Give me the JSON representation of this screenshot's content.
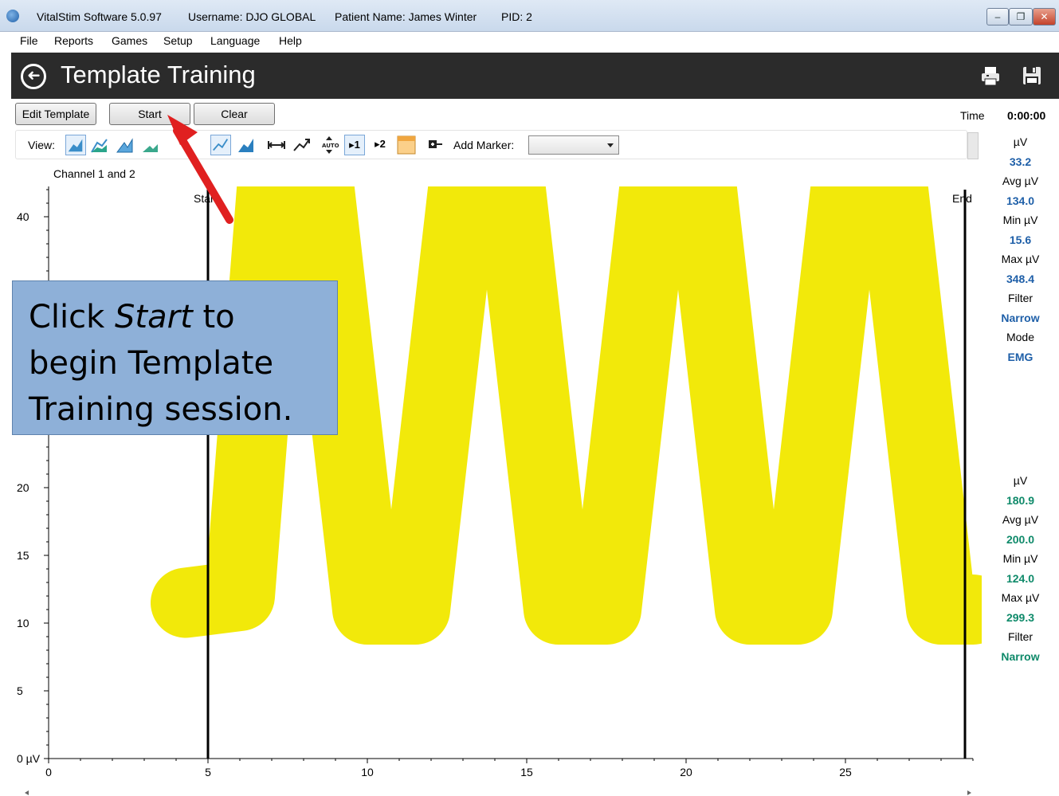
{
  "window": {
    "app_title": "VitalStim Software 5.0.97",
    "username": "Username: DJO GLOBAL",
    "patient": "Patient Name: James Winter",
    "pid": "PID: 2",
    "minimize": "–",
    "maximize": "❐",
    "close": "✕"
  },
  "menu": [
    "File",
    "Reports",
    "Games",
    "Setup",
    "Language",
    "Help"
  ],
  "header": {
    "title": "Template Training",
    "back": "➜"
  },
  "buttons": {
    "edit_template": "Edit Template",
    "start": "Start",
    "clear": "Clear"
  },
  "time": {
    "label": "Time",
    "value": "0:00:00"
  },
  "toolbar": {
    "view_label": "View:",
    "add_marker_label": "Add Marker:",
    "marker_selected": "",
    "channel1": "1",
    "channel2": "2"
  },
  "channel_label": "Channel 1 and 2",
  "stats_ch1": {
    "uv_label": "µV",
    "uv": "33.2",
    "avg_label": "Avg µV",
    "avg": "134.0",
    "min_label": "Min µV",
    "min": "15.6",
    "max_label": "Max µV",
    "max": "348.4",
    "filter_label": "Filter",
    "filter": "Narrow",
    "mode_label": "Mode",
    "mode": "EMG"
  },
  "stats_ch2": {
    "uv_label": "µV",
    "uv": "180.9",
    "avg_label": "Avg µV",
    "avg": "200.0",
    "min_label": "Min µV",
    "min": "124.0",
    "max_label": "Max µV",
    "max": "299.3",
    "filter_label": "Filter",
    "filter": "Narrow"
  },
  "callout": {
    "part1": "Click ",
    "emphasis": "Start",
    "part2": " to begin Template Training session."
  },
  "colors": {
    "template": "#f2e90a",
    "banner": "#2b2b2b",
    "callout": "#8eb0d8",
    "arrow": "#e02020",
    "ch1_value": "#1e5fa8",
    "ch2_value": "#0f8a6a"
  },
  "chart_data": {
    "type": "line",
    "title": "",
    "xlabel": "",
    "ylabel": "",
    "xlim": [
      0,
      29
    ],
    "ylim": [
      0,
      40
    ],
    "x_ticks": [
      "0",
      "5",
      "10",
      "15",
      "20",
      "25"
    ],
    "y_ticks": [
      "0 µV",
      "5",
      "10",
      "15",
      "20",
      "40"
    ],
    "markers": [
      {
        "label": "Start",
        "x": 5
      },
      {
        "label": "End",
        "x": 29
      }
    ],
    "series": [
      {
        "x": [
          4.3,
          6,
          7,
          8.5,
          10,
          11.5,
          13,
          14.5,
          16,
          17.5,
          19,
          20.5,
          22,
          23.5,
          25,
          26.5,
          28,
          29
        ],
        "values": [
          11.5,
          12,
          42,
          42,
          11,
          11,
          42,
          42,
          11,
          11,
          42,
          42,
          11,
          11,
          42,
          42,
          11,
          11
        ]
      }
    ]
  }
}
